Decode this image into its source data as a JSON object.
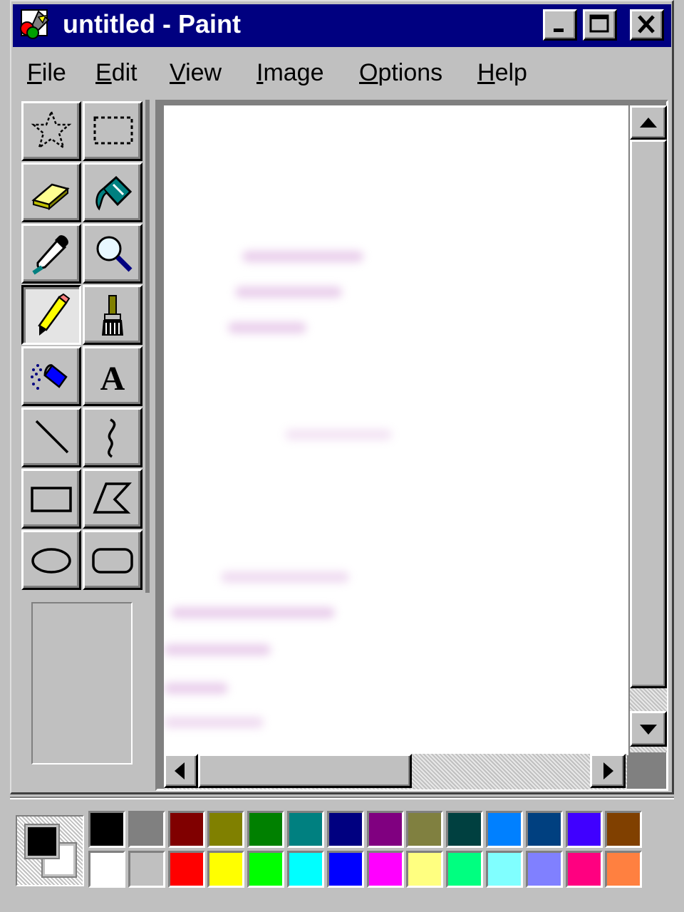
{
  "window": {
    "title": "untitled - Paint",
    "caption_buttons": [
      "minimize",
      "maximize",
      "close"
    ]
  },
  "menu": {
    "items": [
      {
        "label": "File",
        "mnemonic": "F"
      },
      {
        "label": "Edit",
        "mnemonic": "E"
      },
      {
        "label": "View",
        "mnemonic": "V"
      },
      {
        "label": "Image",
        "mnemonic": "I"
      },
      {
        "label": "Options",
        "mnemonic": "O"
      },
      {
        "label": "Help",
        "mnemonic": "H"
      }
    ]
  },
  "tools": [
    {
      "icon": "free-form-select-icon",
      "selected": false
    },
    {
      "icon": "rectangle-select-icon",
      "selected": false
    },
    {
      "icon": "eraser-icon",
      "selected": false
    },
    {
      "icon": "fill-bucket-icon",
      "selected": false
    },
    {
      "icon": "color-picker-icon",
      "selected": false
    },
    {
      "icon": "magnifier-icon",
      "selected": false
    },
    {
      "icon": "pencil-icon",
      "selected": true
    },
    {
      "icon": "brush-icon",
      "selected": false
    },
    {
      "icon": "airbrush-icon",
      "selected": false
    },
    {
      "icon": "text-tool-icon",
      "selected": false
    },
    {
      "icon": "line-icon",
      "selected": false
    },
    {
      "icon": "curve-icon",
      "selected": false
    },
    {
      "icon": "rectangle-icon",
      "selected": false
    },
    {
      "icon": "polygon-icon",
      "selected": false
    },
    {
      "icon": "ellipse-icon",
      "selected": false
    },
    {
      "icon": "rounded-rectangle-icon",
      "selected": false
    }
  ],
  "text_tool_glyph": "A",
  "colors": {
    "foreground": "#000000",
    "background": "#ffffff",
    "title_bar": "#000080",
    "palette_top": [
      "#000000",
      "#808080",
      "#800000",
      "#808000",
      "#008000",
      "#008080",
      "#000080",
      "#800080",
      "#808040",
      "#004040",
      "#0080ff",
      "#004080",
      "#4000ff",
      "#804000"
    ],
    "palette_bottom": [
      "#ffffff",
      "#c0c0c0",
      "#ff0000",
      "#ffff00",
      "#00ff00",
      "#00ffff",
      "#0000ff",
      "#ff00ff",
      "#ffff80",
      "#00ff80",
      "#80ffff",
      "#8080ff",
      "#ff0080",
      "#ff8040"
    ]
  }
}
